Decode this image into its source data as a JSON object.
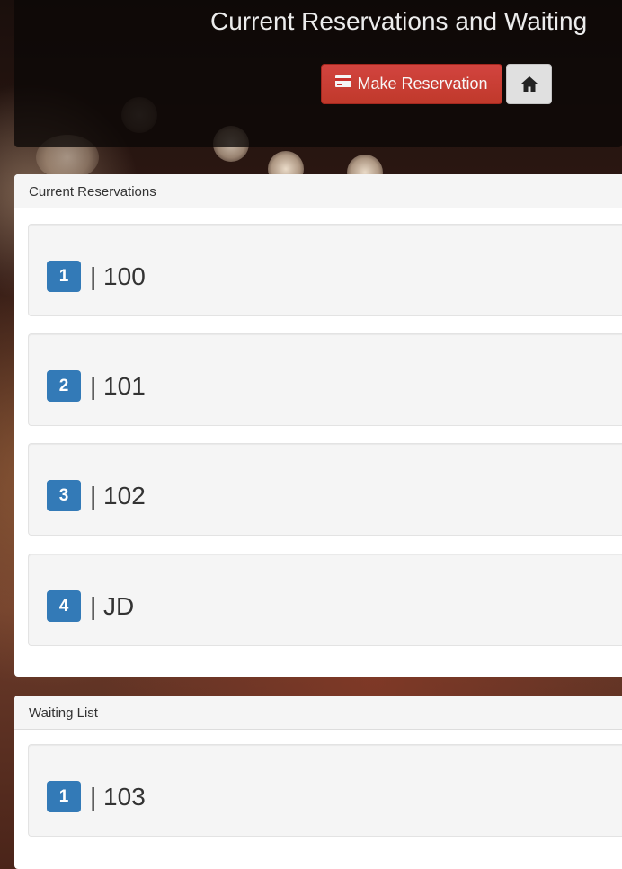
{
  "header": {
    "title": "Current Reservations and Waiting",
    "make_reservation_label": "Make Reservation"
  },
  "icons": {
    "reserve": "credit-card-icon",
    "home": "home-icon"
  },
  "colors": {
    "reserve_button": "#c9302c",
    "badge": "#337ab7",
    "home_button": "#e0e0e0"
  },
  "reservations": {
    "heading": "Current Reservations",
    "items": [
      {
        "badge": "1",
        "text": "| 100"
      },
      {
        "badge": "2",
        "text": "| 101"
      },
      {
        "badge": "3",
        "text": "| 102"
      },
      {
        "badge": "4",
        "text": "| JD"
      }
    ]
  },
  "waiting": {
    "heading": "Waiting List",
    "items": [
      {
        "badge": "1",
        "text": "| 103"
      }
    ]
  }
}
